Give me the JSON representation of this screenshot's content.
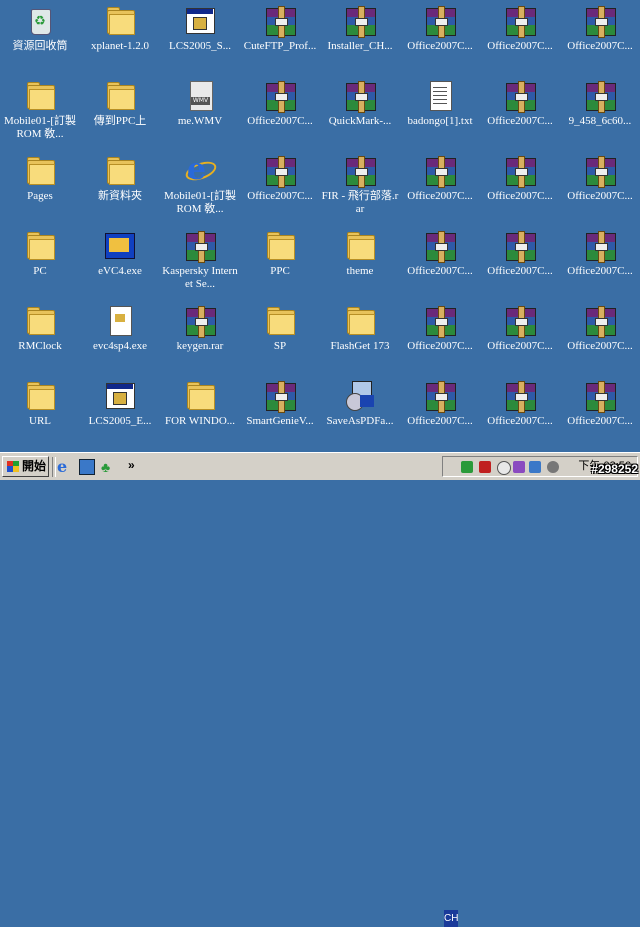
{
  "desktop": {
    "icons": [
      {
        "label": "資源回收筒",
        "type": "recycle-bin"
      },
      {
        "label": "xplanet-1.2.0",
        "type": "folder"
      },
      {
        "label": "LCS2005_S...",
        "type": "exe"
      },
      {
        "label": "CuteFTP_Prof...",
        "type": "winrar"
      },
      {
        "label": "Installer_CH...",
        "type": "winrar"
      },
      {
        "label": "Office2007C...",
        "type": "winrar"
      },
      {
        "label": "Office2007C...",
        "type": "winrar"
      },
      {
        "label": "Office2007C...",
        "type": "winrar"
      },
      {
        "label": "Mobile01-[訂製 ROM 敎...",
        "type": "folder"
      },
      {
        "label": "傳到PPC上",
        "type": "folder"
      },
      {
        "label": "me.WMV",
        "type": "wmv"
      },
      {
        "label": "Office2007C...",
        "type": "winrar"
      },
      {
        "label": "QuickMark-...",
        "type": "winrar"
      },
      {
        "label": "badongo[1].txt",
        "type": "text-doc"
      },
      {
        "label": "Office2007C...",
        "type": "winrar"
      },
      {
        "label": "9_458_6c60...",
        "type": "winrar"
      },
      {
        "label": "Pages",
        "type": "folder"
      },
      {
        "label": "新資料夾",
        "type": "folder"
      },
      {
        "label": "Mobile01-[訂製 ROM 敎...",
        "type": "ie-html"
      },
      {
        "label": "Office2007C...",
        "type": "winrar"
      },
      {
        "label": "FIR - 飛行部落.rar",
        "type": "winrar"
      },
      {
        "label": "Office2007C...",
        "type": "winrar"
      },
      {
        "label": "Office2007C...",
        "type": "winrar"
      },
      {
        "label": "Office2007C...",
        "type": "winrar"
      },
      {
        "label": "PC",
        "type": "folder"
      },
      {
        "label": "eVC4.exe",
        "type": "evc"
      },
      {
        "label": "Kaspersky Internet Se...",
        "type": "winrar"
      },
      {
        "label": "PPC",
        "type": "folder"
      },
      {
        "label": "theme",
        "type": "folder"
      },
      {
        "label": "Office2007C...",
        "type": "winrar"
      },
      {
        "label": "Office2007C...",
        "type": "winrar"
      },
      {
        "label": "Office2007C...",
        "type": "winrar"
      },
      {
        "label": "RMClock",
        "type": "folder"
      },
      {
        "label": "evc4sp4.exe",
        "type": "doc-exe"
      },
      {
        "label": "keygen.rar",
        "type": "winrar"
      },
      {
        "label": "SP",
        "type": "folder"
      },
      {
        "label": "FlashGet 173",
        "type": "folder"
      },
      {
        "label": "Office2007C...",
        "type": "winrar"
      },
      {
        "label": "Office2007C...",
        "type": "winrar"
      },
      {
        "label": "Office2007C...",
        "type": "winrar"
      },
      {
        "label": "URL",
        "type": "folder"
      },
      {
        "label": "LCS2005_E...",
        "type": "exe"
      },
      {
        "label": "FOR WINDO...",
        "type": "folder"
      },
      {
        "label": "SmartGenieV...",
        "type": "winrar"
      },
      {
        "label": "SaveAsPDFa...",
        "type": "setup"
      },
      {
        "label": "Office2007C...",
        "type": "winrar"
      },
      {
        "label": "Office2007C...",
        "type": "winrar"
      },
      {
        "label": "Office2007C...",
        "type": "winrar"
      }
    ]
  },
  "taskbar": {
    "start_label": "開始",
    "more_glyph": "»",
    "ime_label": "CH",
    "clock": "下午 03:56"
  },
  "watermark": "#298252",
  "colors": {
    "desktop": "#3a6ea5",
    "taskbar": "#d4d0c8"
  }
}
